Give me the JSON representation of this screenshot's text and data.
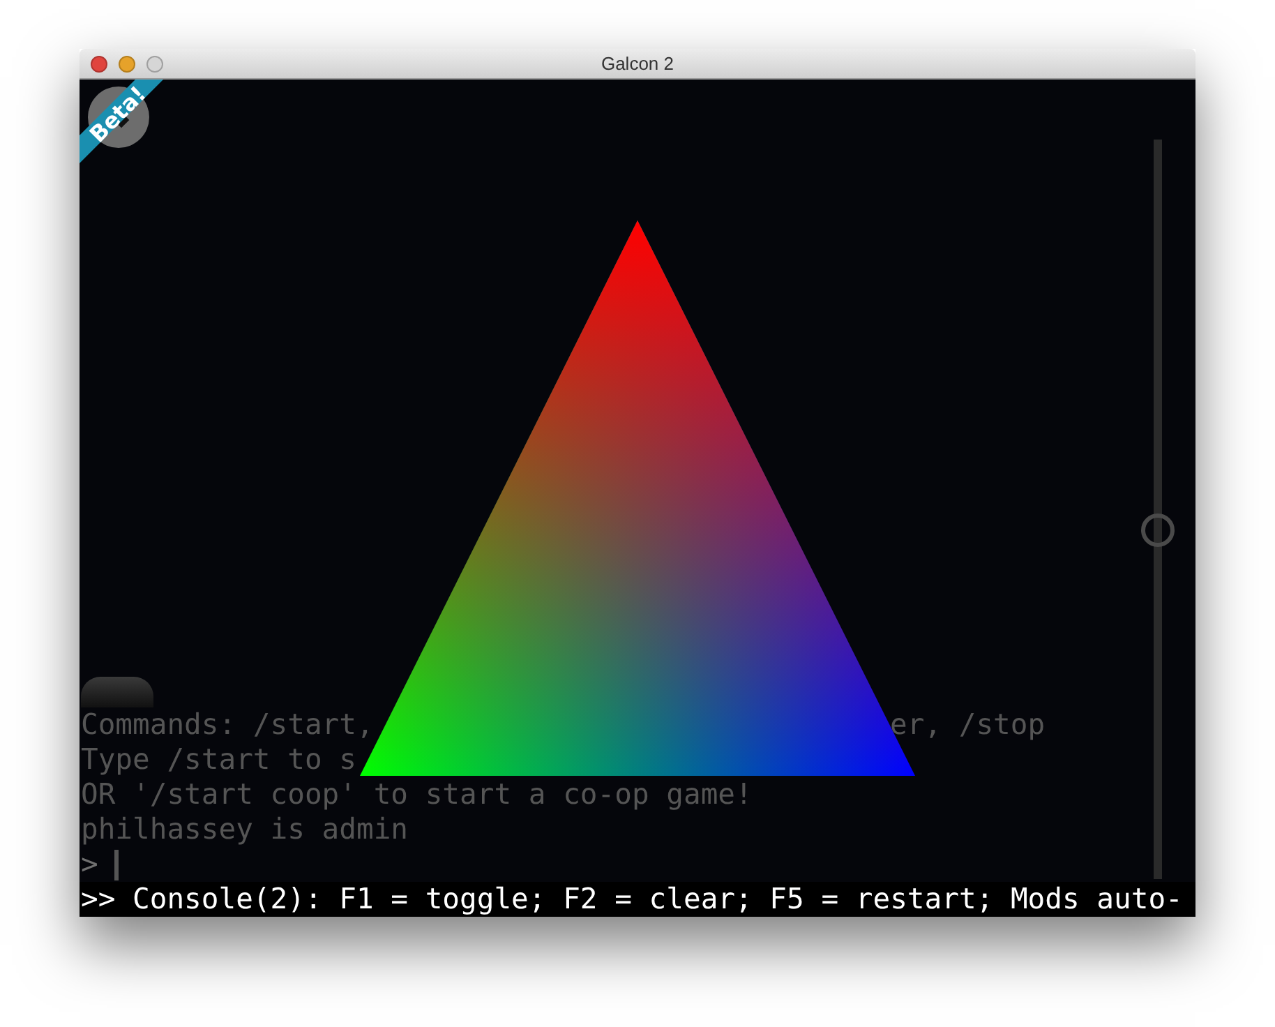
{
  "window": {
    "title": "Galcon 2"
  },
  "badge": {
    "text": "Beta!"
  },
  "zoom_slider": {
    "level": 0.47
  },
  "console": {
    "lines": [
      "Commands: /start,",
      "Type /start to s",
      "OR '/start coop' to start a co-op game!",
      "philhassey is admin"
    ],
    "line_1_end": "er, /stop",
    "prompt": ">",
    "status": ">> Console(2): F1 = toggle; F2 = clear; F5 = restart; Mods auto-"
  }
}
